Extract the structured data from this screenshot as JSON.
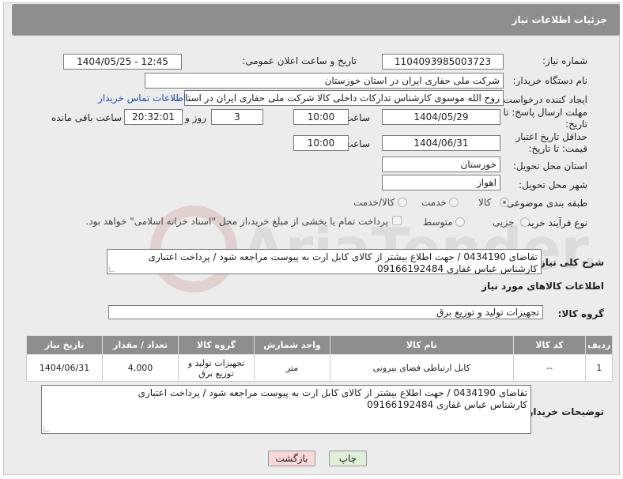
{
  "header": {
    "title": "جزئیات اطلاعات نیاز"
  },
  "labels": {
    "need_number": "شماره نیاز:",
    "announce_datetime": "تاریخ و ساعت اعلان عمومی:",
    "buyer_org": "نام دستگاه خریدار:",
    "requester": "ایجاد کننده درخواست:",
    "deadline": "مهلت ارسال پاسخ: تا تاریخ:",
    "hour1": "ساعت",
    "day_and": "روز و",
    "remaining": "ساعت باقی مانده",
    "price_validity": "حداقل تاریخ اعتبار قیمت: تا تاریخ:",
    "hour2": "ساعت",
    "province": "استان محل تحویل:",
    "city": "شهر محل تحویل:",
    "category": "طبقه بندی موضوعی:",
    "process": "نوع فرآیند خرید :",
    "description": "شرح کلی نیاز:",
    "goods_info": "اطلاعات کالاهای مورد نیاز",
    "goods_group": "گروه کالا:",
    "buyer_notes": "توضیحات خریدار:"
  },
  "values": {
    "need_number": "1104093985003723",
    "announce_datetime": "1404/05/25 - 12:45",
    "buyer_org": "شرکت ملی حفاری ایران در استان خوزستان",
    "requester": "روح الله موسوی کارشناس تدارکات داخلی کالا شرکت ملی حفاری ایران در استان",
    "contact_link": "اطلاعات تماس خریدار",
    "deadline_date": "1404/05/29",
    "deadline_time": "10:00",
    "days": "3",
    "remaining_time": "20:32:01",
    "validity_date": "1404/06/31",
    "validity_time": "10:00",
    "province": "خوزستان",
    "city": "اهواز",
    "goods_group": "تجهیزات تولید و توزیع برق"
  },
  "category_options": {
    "goods": "کالا",
    "service": "خدمت",
    "goods_service": "کالا/خدمت"
  },
  "process_options": {
    "partial": "جزیی",
    "medium": "متوسط",
    "payment_note": "پرداخت تمام یا بخشی از مبلغ خرید،از محل \"اسناد خزانه اسلامی\" خواهد بود."
  },
  "description_text": {
    "line1": "تقاضای 0434190 / جهت اطلاع بیشتر از کالای  کابل ارت به پیوست مراجعه شود / پرداخت اعتباری",
    "line2": "کارشناس عباس غفاری 09166192484"
  },
  "table": {
    "headers": [
      "ردیف",
      "کد کالا",
      "نام کالا",
      "واحد شمارش",
      "گروه کالا",
      "تعداد / مقدار",
      "تاریخ نیاز"
    ],
    "rows": [
      {
        "row": "1",
        "code": "--",
        "name": "کابل ارتباطی فضای بیرونی",
        "unit": "متر",
        "group": "تجهیزات تولید و توزیع برق",
        "qty": "4,000",
        "date": "1404/06/31"
      }
    ]
  },
  "notes_text": {
    "line1": "تقاضای 0434190 / جهت اطلاع بیشتر از کالای  کابل ارت به پیوست مراجعه شود / پرداخت اعتباری",
    "line2": "کارشناس عباس غفاری 09166192484"
  },
  "buttons": {
    "print": "چاپ",
    "back": "بازگشت"
  },
  "watermark": {
    "text": "AriaTender.neT"
  },
  "colors": {
    "header_bg": "#8e8e8e",
    "panel_bg": "#ececec",
    "link": "#1a4fb5",
    "back_button_bg": "#f8d7d7",
    "print_button_bg": "#e0f0d8"
  }
}
